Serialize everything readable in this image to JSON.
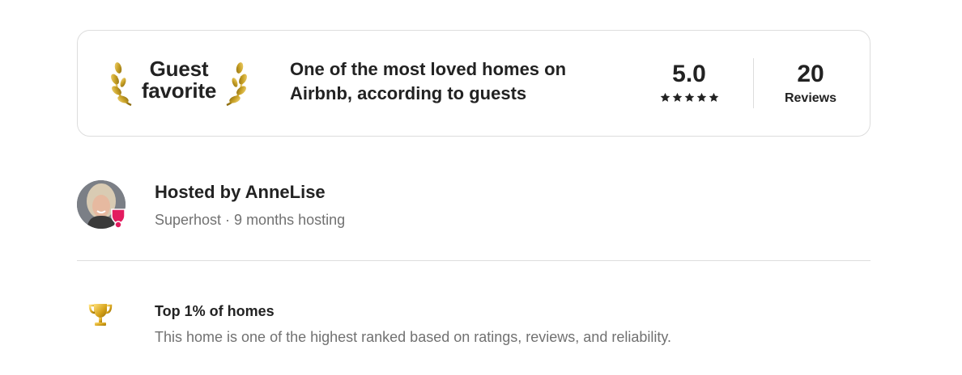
{
  "guest_favorite": {
    "title": "Guest favorite",
    "description": "One of the most loved homes on Airbnb, according to guests",
    "rating": "5.0",
    "stars_filled": 5,
    "stars_total": 5,
    "reviews_count": "20",
    "reviews_label": "Reviews",
    "icons": [
      "laurel-left-icon",
      "laurel-right-icon",
      "star-icon"
    ]
  },
  "host": {
    "title": "Hosted by AnneLise",
    "meta": "Superhost · 9 months hosting",
    "badge_icon": "superhost-badge-icon",
    "badge_color": "#e31c5f"
  },
  "highlight": {
    "icon": "trophy-icon",
    "title": "Top 1% of homes",
    "description": "This home is one of the highest ranked based on ratings, reviews, and reliability."
  },
  "colors": {
    "text_primary": "#222222",
    "text_secondary": "#717171",
    "border": "#dddddd",
    "gold": "#c9a227"
  }
}
